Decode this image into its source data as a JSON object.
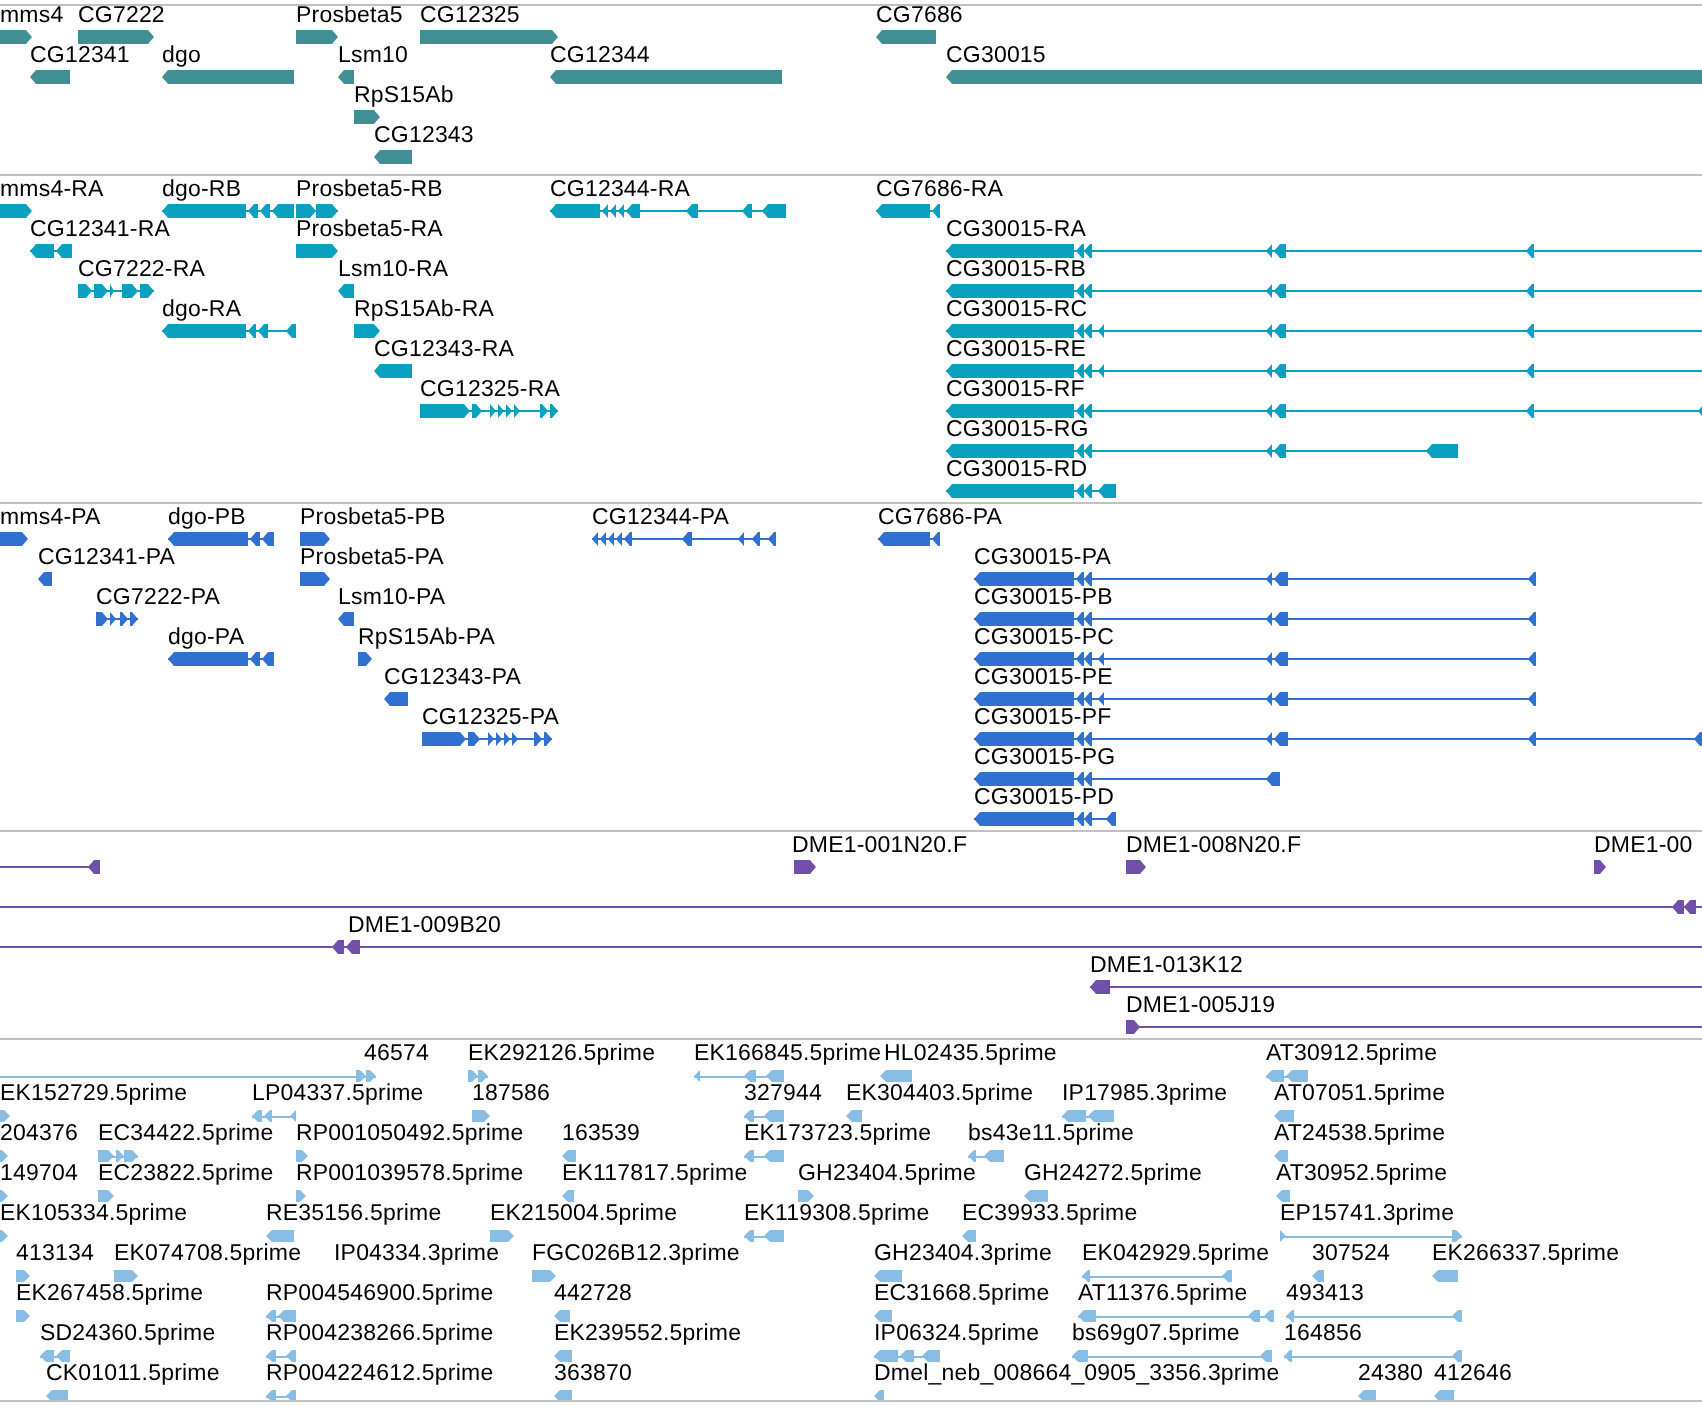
{
  "tracks": [
    {
      "color": "#3f8f95",
      "features": [
        {
          "label": "mms4",
          "reverse": false
        },
        {
          "label": "CG7222",
          "reverse": false
        },
        {
          "label": "Prosbeta5",
          "reverse": false
        },
        {
          "label": "CG12325",
          "reverse": false
        },
        {
          "label": "CG7686",
          "reverse": true
        },
        {
          "label": "CG12341",
          "reverse": true
        },
        {
          "label": "dgo",
          "reverse": true
        },
        {
          "label": "Lsm10",
          "reverse": true
        },
        {
          "label": "CG12344",
          "reverse": true
        },
        {
          "label": "CG30015",
          "reverse": true
        },
        {
          "label": "RpS15Ab",
          "reverse": false
        },
        {
          "label": "CG12343",
          "reverse": true
        }
      ]
    },
    {
      "color": "#0aa0c0",
      "features": [
        {
          "label": "mms4-RA",
          "reverse": false
        },
        {
          "label": "dgo-RB",
          "reverse": true
        },
        {
          "label": "Prosbeta5-RB",
          "reverse": false
        },
        {
          "label": "CG12344-RA",
          "reverse": true
        },
        {
          "label": "CG7686-RA",
          "reverse": true
        },
        {
          "label": "CG12341-RA",
          "reverse": true
        },
        {
          "label": "Prosbeta5-RA",
          "reverse": false
        },
        {
          "label": "CG30015-RA",
          "reverse": true
        },
        {
          "label": "CG7222-RA",
          "reverse": false
        },
        {
          "label": "Lsm10-RA",
          "reverse": true
        },
        {
          "label": "CG30015-RB",
          "reverse": true
        },
        {
          "label": "dgo-RA",
          "reverse": true
        },
        {
          "label": "RpS15Ab-RA",
          "reverse": false
        },
        {
          "label": "CG30015-RC",
          "reverse": true
        },
        {
          "label": "CG12343-RA",
          "reverse": true
        },
        {
          "label": "CG30015-RE",
          "reverse": true
        },
        {
          "label": "CG12325-RA",
          "reverse": false
        },
        {
          "label": "CG30015-RF",
          "reverse": true
        },
        {
          "label": "CG30015-RG",
          "reverse": true
        },
        {
          "label": "CG30015-RD",
          "reverse": true
        }
      ]
    },
    {
      "color": "#3070d0",
      "features": [
        {
          "label": "mms4-PA",
          "reverse": false
        },
        {
          "label": "dgo-PB",
          "reverse": true
        },
        {
          "label": "Prosbeta5-PB",
          "reverse": false
        },
        {
          "label": "CG12344-PA",
          "reverse": true
        },
        {
          "label": "CG7686-PA",
          "reverse": true
        },
        {
          "label": "CG12341-PA",
          "reverse": true
        },
        {
          "label": "Prosbeta5-PA",
          "reverse": false
        },
        {
          "label": "CG30015-PA",
          "reverse": true
        },
        {
          "label": "CG7222-PA",
          "reverse": false
        },
        {
          "label": "Lsm10-PA",
          "reverse": true
        },
        {
          "label": "CG30015-PB",
          "reverse": true
        },
        {
          "label": "dgo-PA",
          "reverse": true
        },
        {
          "label": "RpS15Ab-PA",
          "reverse": false
        },
        {
          "label": "CG30015-PC",
          "reverse": true
        },
        {
          "label": "CG12343-PA",
          "reverse": true
        },
        {
          "label": "CG30015-PE",
          "reverse": true
        },
        {
          "label": "CG12325-PA",
          "reverse": false
        },
        {
          "label": "CG30015-PF",
          "reverse": true
        },
        {
          "label": "CG30015-PG",
          "reverse": true
        },
        {
          "label": "CG30015-PD",
          "reverse": true
        }
      ]
    },
    {
      "color": "#7050a8",
      "features": [
        {
          "reverse": true
        },
        {
          "label": "DME1-001N20.F",
          "reverse": false
        },
        {
          "label": "DME1-008N20.F",
          "reverse": false
        },
        {
          "label": "DME1-00",
          "reverse": false
        },
        {
          "reverse": true
        },
        {
          "label": "DME1-009B20",
          "reverse": true
        },
        {
          "label": "DME1-013K12",
          "reverse": true
        },
        {
          "label": "DME1-005J19",
          "reverse": false
        }
      ]
    },
    {
      "color": "#88bde6",
      "features": [
        {
          "label": "46574",
          "reverse": false
        },
        {
          "label": "EK292126.5prime",
          "reverse": false
        },
        {
          "label": "EK166845.5prime",
          "reverse": true
        },
        {
          "label": "HL02435.5prime",
          "reverse": true
        },
        {
          "label": "AT30912.5prime",
          "reverse": true
        },
        {
          "label": "EK152729.5prime",
          "reverse": false
        },
        {
          "label": "LP04337.5prime",
          "reverse": true
        },
        {
          "label": "187586",
          "reverse": false
        },
        {
          "label": "327944",
          "reverse": true
        },
        {
          "label": "EK304403.5prime",
          "reverse": true
        },
        {
          "label": "IP17985.3prime",
          "reverse": true
        },
        {
          "label": "AT07051.5prime",
          "reverse": true
        },
        {
          "label": "204376",
          "reverse": false
        },
        {
          "label": "EC34422.5prime",
          "reverse": false
        },
        {
          "label": "RP001050492.5prime",
          "reverse": false
        },
        {
          "label": "163539",
          "reverse": true
        },
        {
          "label": "EK173723.5prime",
          "reverse": true
        },
        {
          "label": "bs43e11.5prime",
          "reverse": true
        },
        {
          "label": "AT24538.5prime",
          "reverse": true
        },
        {
          "label": "149704",
          "reverse": false
        },
        {
          "label": "EC23822.5prime",
          "reverse": false
        },
        {
          "label": "RP001039578.5prime",
          "reverse": false
        },
        {
          "label": "EK117817.5prime",
          "reverse": true
        },
        {
          "label": "GH23404.5prime",
          "reverse": false
        },
        {
          "label": "GH24272.5prime",
          "reverse": true
        },
        {
          "label": "AT30952.5prime",
          "reverse": true
        },
        {
          "label": "EK105334.5prime",
          "reverse": false
        },
        {
          "label": "RE35156.5prime",
          "reverse": true
        },
        {
          "label": "EK215004.5prime",
          "reverse": false
        },
        {
          "label": "EK119308.5prime",
          "reverse": true
        },
        {
          "label": "EC39933.5prime",
          "reverse": true
        },
        {
          "label": "EP15741.3prime",
          "reverse": false
        },
        {
          "label": "413134",
          "reverse": false
        },
        {
          "label": "EK074708.5prime",
          "reverse": false
        },
        {
          "label": "IP04334.3prime"
        },
        {
          "label": "FGC026B12.3prime",
          "reverse": false
        },
        {
          "label": "GH23404.3prime",
          "reverse": true
        },
        {
          "label": "EK042929.5prime",
          "reverse": true
        },
        {
          "label": "307524",
          "reverse": true
        },
        {
          "label": "EK266337.5prime",
          "reverse": true
        },
        {
          "label": "EK267458.5prime",
          "reverse": false
        },
        {
          "label": "RP004546900.5prime",
          "reverse": true
        },
        {
          "label": "442728",
          "reverse": true
        },
        {
          "label": "EC31668.5prime",
          "reverse": true
        },
        {
          "label": "AT11376.5prime",
          "reverse": true
        },
        {
          "label": "493413",
          "reverse": true
        },
        {
          "label": "SD24360.5prime",
          "reverse": true
        },
        {
          "label": "RP004238266.5prime",
          "reverse": true
        },
        {
          "label": "EK239552.5prime",
          "reverse": true
        },
        {
          "label": "IP06324.5prime",
          "reverse": true
        },
        {
          "label": "bs69g07.5prime",
          "reverse": true
        },
        {
          "label": "164856",
          "reverse": true
        },
        {
          "label": "CK01011.5prime",
          "reverse": true
        },
        {
          "label": "RP004224612.5prime",
          "reverse": true
        },
        {
          "label": "363870",
          "reverse": true
        },
        {
          "label": "Dmel_neb_008664_0905_3356.3prime",
          "reverse": true
        },
        {
          "label": "24380",
          "reverse": true
        },
        {
          "label": "412646",
          "reverse": true
        }
      ]
    }
  ]
}
